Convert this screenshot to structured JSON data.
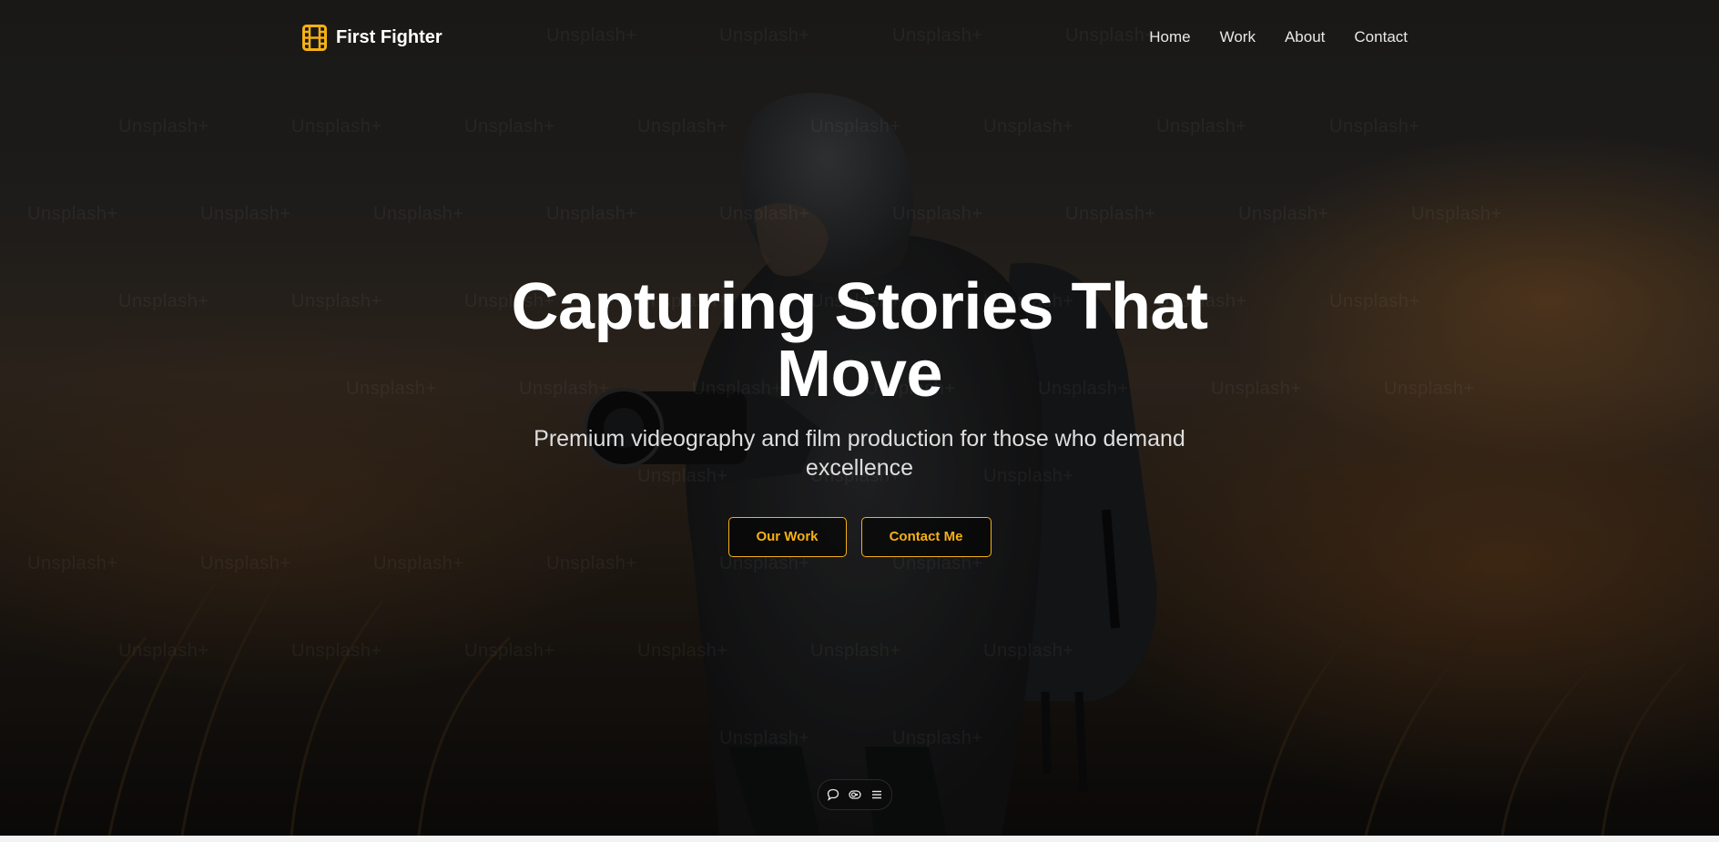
{
  "brand": {
    "name": "First Fighter",
    "icon": "film-icon",
    "accent_color": "#f5b014"
  },
  "nav": {
    "links": [
      "Home",
      "Work",
      "About",
      "Contact"
    ]
  },
  "hero": {
    "title": "Capturing Stories That Move",
    "subtitle": "Premium videography and film production for those who demand excellence",
    "primary_cta": "Our Work",
    "secondary_cta": "Contact Me"
  },
  "watermark": {
    "text": "Unsplash+"
  },
  "toolbar": {
    "icons": [
      "comment-icon",
      "eye-toggle-icon",
      "menu-icon"
    ]
  }
}
